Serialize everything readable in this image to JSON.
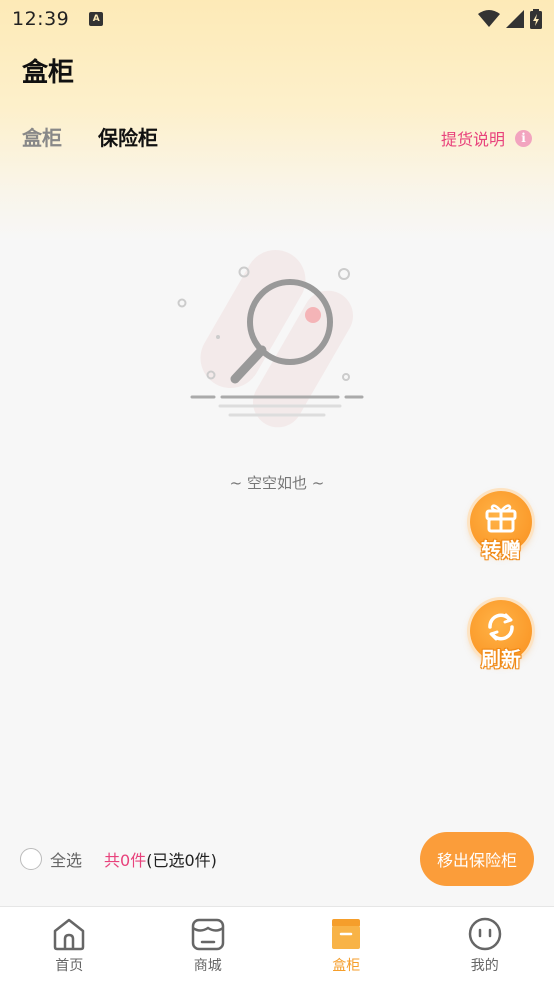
{
  "status_bar": {
    "time": "12:39",
    "notif_icon": "A"
  },
  "header": {
    "title": "盒柜"
  },
  "tabs": [
    {
      "label": "盒柜",
      "active": false
    },
    {
      "label": "保险柜",
      "active": true
    }
  ],
  "help_link": {
    "label": "提货说明",
    "icon": "i"
  },
  "empty_state": {
    "text": "~ 空空如也 ~"
  },
  "float_buttons": {
    "gift_label": "转赠",
    "refresh_label": "刷新"
  },
  "bottom_bar": {
    "select_all_label": "全选",
    "count_prefix": "共",
    "count_value": "0件",
    "count_suffix": "(已选0件)",
    "move_out_label": "移出保险柜"
  },
  "tabbar": [
    {
      "label": "首页",
      "icon": "home-icon"
    },
    {
      "label": "商城",
      "icon": "store-icon"
    },
    {
      "label": "盒柜",
      "icon": "box-icon",
      "active": true
    },
    {
      "label": "我的",
      "icon": "profile-icon"
    }
  ],
  "colors": {
    "accent_orange": "#fb9d3a",
    "accent_pink": "#e8427c",
    "header_gradient": "#fdeab7"
  }
}
